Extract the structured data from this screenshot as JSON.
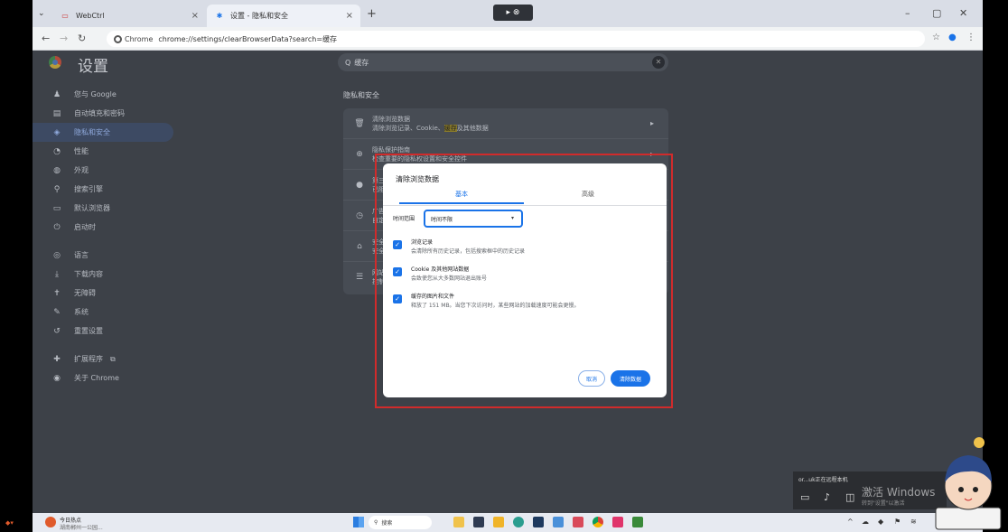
{
  "browser": {
    "tabs": [
      {
        "icon": "webctrl-icon",
        "label": "WebCtrl"
      },
      {
        "icon": "gear-icon",
        "label": "设置 - 隐私和安全"
      }
    ],
    "new_tab": "+",
    "share_pill": "▸ ⊗",
    "url_chip": "Chrome",
    "url": "chrome://settings/clearBrowserData?search=缓存"
  },
  "settings": {
    "title": "设置",
    "search_value": "缓存",
    "sidebar": [
      {
        "icon": "person-icon",
        "label": "您与 Google"
      },
      {
        "icon": "autofill-icon",
        "label": "自动填充和密码"
      },
      {
        "icon": "shield-icon",
        "label": "隐私和安全",
        "active": true
      },
      {
        "icon": "performance-icon",
        "label": "性能"
      },
      {
        "icon": "palette-icon",
        "label": "外观"
      },
      {
        "icon": "search-icon",
        "label": "搜索引擎"
      },
      {
        "icon": "browser-icon",
        "label": "默认浏览器"
      },
      {
        "icon": "power-icon",
        "label": "启动时"
      },
      {
        "icon": "globe-icon",
        "label": "语言"
      },
      {
        "icon": "download-icon",
        "label": "下载内容"
      },
      {
        "icon": "accessibility-icon",
        "label": "无障碍"
      },
      {
        "icon": "wrench-icon",
        "label": "系统"
      },
      {
        "icon": "reset-icon",
        "label": "重置设置"
      },
      {
        "icon": "extension-icon",
        "label": "扩展程序"
      },
      {
        "icon": "chrome-icon",
        "label": "关于 Chrome"
      }
    ],
    "section_title": "隐私和安全",
    "rows": [
      {
        "title": "清除浏览数据",
        "sub_before": "清除浏览记录、Cookie、",
        "sub_hl": "缓存",
        "sub_after": "及其他数据"
      },
      {
        "title": "隐私保护指南",
        "sub_before": "检查重要的隐私权设置和安全控件",
        "sub_hl": "",
        "sub_after": ""
      },
      {
        "title": "第三",
        "sub_before": "已阻",
        "sub_hl": "",
        "sub_after": ""
      },
      {
        "title": "广告",
        "sub_before": "自定",
        "sub_hl": "",
        "sub_after": ""
      },
      {
        "title": "安全",
        "sub_before": "安全",
        "sub_hl": "",
        "sub_after": ""
      },
      {
        "title": "网站",
        "sub_before": "控制",
        "sub_hl": "",
        "sub_after": ""
      }
    ]
  },
  "dialog": {
    "title": "清除浏览数据",
    "tab_basic": "基本",
    "tab_advanced": "高级",
    "time_range_label": "时间范围",
    "time_range_value": "时间不限",
    "options": [
      {
        "title": "浏览记录",
        "desc": "会清除所有历史记录，包括搜索框中的历史记录",
        "checked": true
      },
      {
        "title": "Cookie 及其他网站数据",
        "desc": "会致使您从大多数网站退出账号",
        "checked": true
      },
      {
        "title": "缓存的图片和文件",
        "desc": "释放了 151 MB。当您下次访问时，某些网站的加载速度可能会更慢。",
        "checked": true
      }
    ],
    "cancel": "取消",
    "clear": "清除数据"
  },
  "remote": {
    "text": "or...uk正在远程本机",
    "watermark": "激活 Windows",
    "watermark_sub": "转到\"设置\"以激活"
  },
  "taskbar": {
    "news_title": "今日热点",
    "news_sub": "湖南郴州一公园...",
    "search": "搜索",
    "accent": "#1a73e8"
  }
}
